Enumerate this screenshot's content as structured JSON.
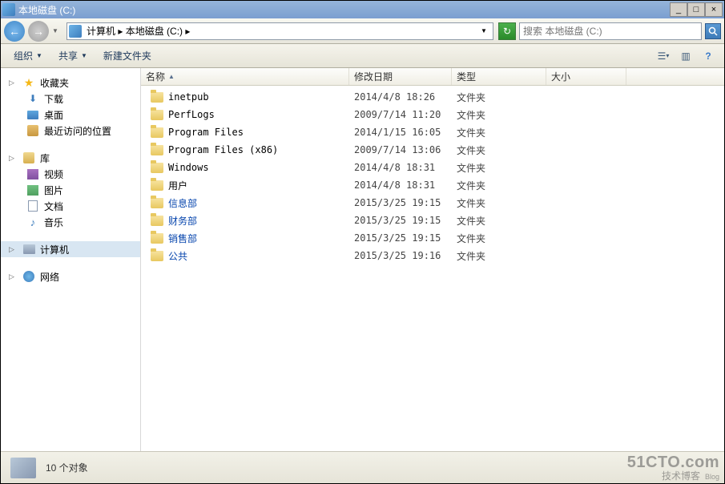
{
  "titlebar": {
    "title": "本地磁盘 (C:)"
  },
  "address": {
    "path": "计算机 ▸ 本地磁盘 (C:) ▸"
  },
  "search": {
    "placeholder": "搜索 本地磁盘 (C:)"
  },
  "toolbar": {
    "organize": "组织",
    "share": "共享",
    "newfolder": "新建文件夹"
  },
  "sidebar": {
    "favorites": {
      "label": "收藏夹",
      "items": [
        {
          "label": "下载"
        },
        {
          "label": "桌面"
        },
        {
          "label": "最近访问的位置"
        }
      ]
    },
    "libraries": {
      "label": "库",
      "items": [
        {
          "label": "视频"
        },
        {
          "label": "图片"
        },
        {
          "label": "文档"
        },
        {
          "label": "音乐"
        }
      ]
    },
    "computer": {
      "label": "计算机"
    },
    "network": {
      "label": "网络"
    }
  },
  "columns": {
    "name": "名称",
    "date": "修改日期",
    "type": "类型",
    "size": "大小"
  },
  "rows": [
    {
      "name": "inetpub",
      "date": "2014/4/8 18:26",
      "type": "文件夹",
      "link": false
    },
    {
      "name": "PerfLogs",
      "date": "2009/7/14 11:20",
      "type": "文件夹",
      "link": false
    },
    {
      "name": "Program Files",
      "date": "2014/1/15 16:05",
      "type": "文件夹",
      "link": false
    },
    {
      "name": "Program Files (x86)",
      "date": "2009/7/14 13:06",
      "type": "文件夹",
      "link": false
    },
    {
      "name": "Windows",
      "date": "2014/4/8 18:31",
      "type": "文件夹",
      "link": false
    },
    {
      "name": "用户",
      "date": "2014/4/8 18:31",
      "type": "文件夹",
      "link": false
    },
    {
      "name": "信息部",
      "date": "2015/3/25 19:15",
      "type": "文件夹",
      "link": true
    },
    {
      "name": "财务部",
      "date": "2015/3/25 19:15",
      "type": "文件夹",
      "link": true
    },
    {
      "name": "销售部",
      "date": "2015/3/25 19:15",
      "type": "文件夹",
      "link": true
    },
    {
      "name": "公共",
      "date": "2015/3/25 19:16",
      "type": "文件夹",
      "link": true
    }
  ],
  "status": {
    "text": "10 个对象"
  },
  "watermark": {
    "top": "51CTO.com",
    "bot": "技术博客",
    "blog": "Blog"
  }
}
